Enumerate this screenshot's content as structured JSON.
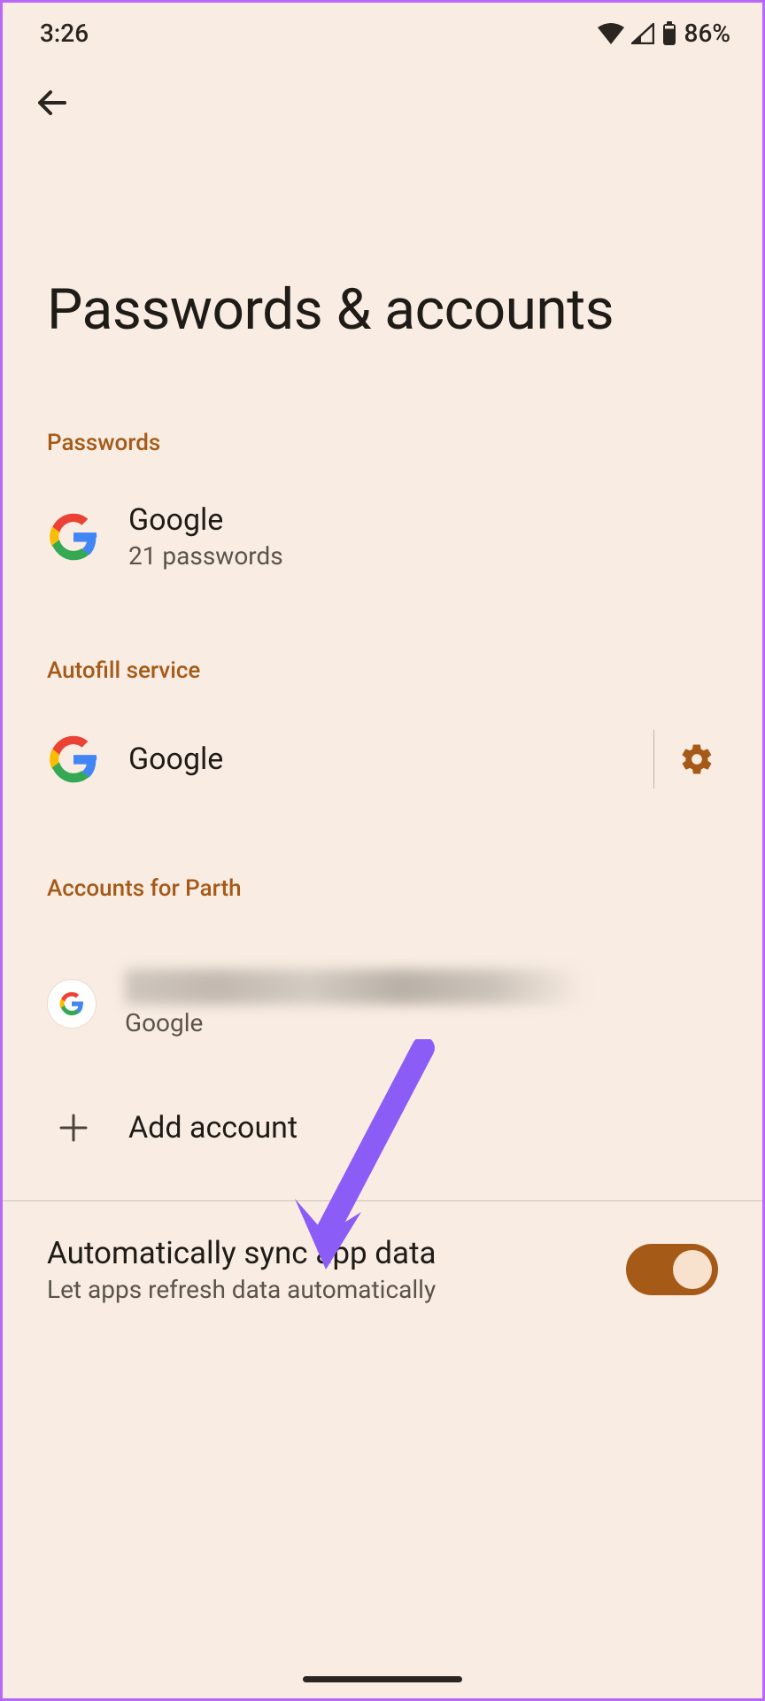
{
  "status": {
    "time": "3:26",
    "battery": "86%"
  },
  "page": {
    "title": "Passwords & accounts"
  },
  "sections": {
    "passwords_header": "Passwords",
    "autofill_header": "Autofill service",
    "accounts_header": "Accounts for Parth"
  },
  "passwords_item": {
    "title": "Google",
    "subtitle": "21 passwords"
  },
  "autofill_item": {
    "title": "Google"
  },
  "account_item": {
    "subtitle": "Google"
  },
  "add_account": {
    "label": "Add account"
  },
  "sync": {
    "title": "Automatically sync app data",
    "subtitle": "Let apps refresh data automatically",
    "enabled": true
  }
}
